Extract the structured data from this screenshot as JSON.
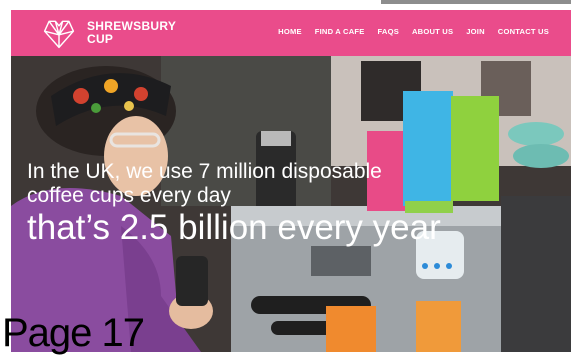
{
  "brand": {
    "name_line1": "SHREWSBURY",
    "name_line2": "CUP",
    "logo_icon": "heart-cup-logo-icon"
  },
  "nav": {
    "items": [
      {
        "label": "HOME"
      },
      {
        "label": "FIND A CAFE"
      },
      {
        "label": "FAQS"
      },
      {
        "label": "ABOUT US"
      },
      {
        "label": "JOIN"
      },
      {
        "label": "CONTACT US"
      }
    ]
  },
  "hero": {
    "line1": "In the UK, we use 7 million disposable",
    "line1b": "coffee cups every day",
    "line2": "that’s 2.5 billion every year"
  },
  "page_label": "Page 17",
  "colors": {
    "nav_background": "#ea4c8b",
    "text_on_nav": "#ffffff"
  }
}
